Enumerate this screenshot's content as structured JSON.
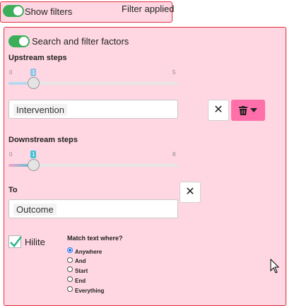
{
  "top_bar": {
    "toggle_on": true,
    "label": "Show filters",
    "status": "Filter applied"
  },
  "panel": {
    "search_toggle_on": true,
    "search_label": "Search and filter factors",
    "upstream": {
      "label": "Upstream steps",
      "min": "0",
      "max": "5",
      "value": "1",
      "accent": "#90c4e6"
    },
    "downstream": {
      "label": "Downstream steps",
      "min": "0",
      "max": "8",
      "value": "1",
      "accent": "#46c2d8"
    },
    "from_value": "Intervention",
    "to_label": "To",
    "to_value": "Outcome",
    "hilite": {
      "checked": true,
      "label": "Hilite"
    },
    "match": {
      "label": "Match text where?",
      "options": [
        "Anywhere",
        "And",
        "Start",
        "End",
        "Everything"
      ],
      "selected": "Anywhere"
    }
  },
  "colors": {
    "panel_bg": "#ffd7e3",
    "border": "#e0313d",
    "toggle": "#3cae5a",
    "delete_button": "#ff6fa9"
  }
}
